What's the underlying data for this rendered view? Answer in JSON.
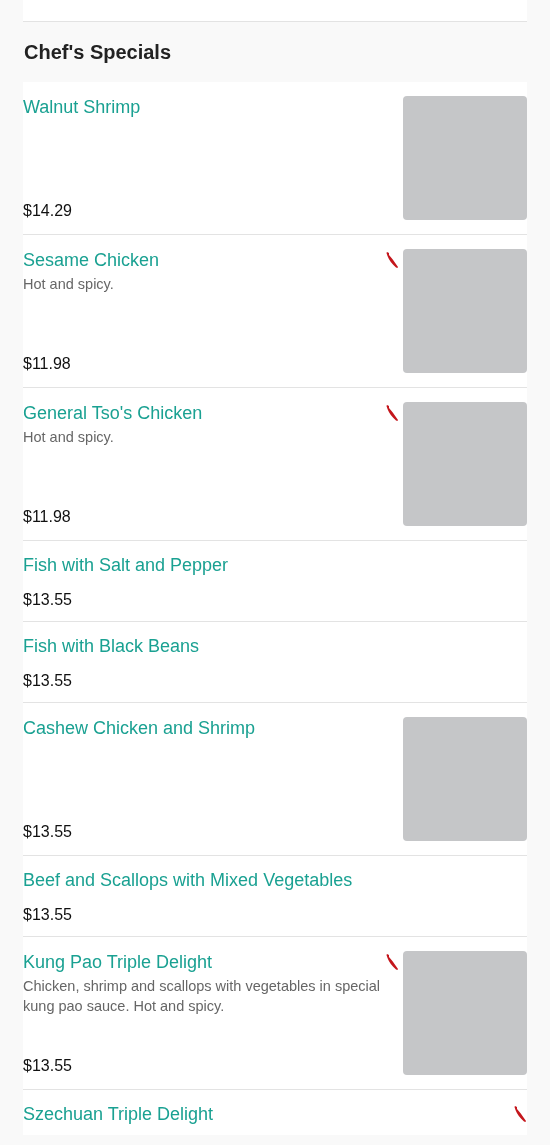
{
  "section_title": "Chef's Specials",
  "items": [
    {
      "name": "Walnut Shrimp",
      "price": "$14.29",
      "spicy": false,
      "image": true
    },
    {
      "name": "Sesame Chicken",
      "description": "Hot and spicy.",
      "price": "$11.98",
      "spicy": true,
      "image": true
    },
    {
      "name": "General Tso's Chicken",
      "description": "Hot and spicy.",
      "price": "$11.98",
      "spicy": true,
      "image": true
    },
    {
      "name": "Fish with Salt and Pepper",
      "price": "$13.55",
      "spicy": false,
      "image": false
    },
    {
      "name": "Fish with Black Beans",
      "price": "$13.55",
      "spicy": false,
      "image": false
    },
    {
      "name": "Cashew Chicken and Shrimp",
      "price": "$13.55",
      "spicy": false,
      "image": true
    },
    {
      "name": "Beef and Scallops with Mixed Vegetables",
      "price": "$13.55",
      "spicy": false,
      "image": false
    },
    {
      "name": "Kung Pao Triple Delight",
      "description": "Chicken, shrimp and scallops with vegetables in special kung pao sauce. Hot and spicy.",
      "price": "$13.55",
      "spicy": true,
      "image": true
    },
    {
      "name": "Szechuan Triple Delight",
      "spicy": true,
      "image": false
    }
  ]
}
